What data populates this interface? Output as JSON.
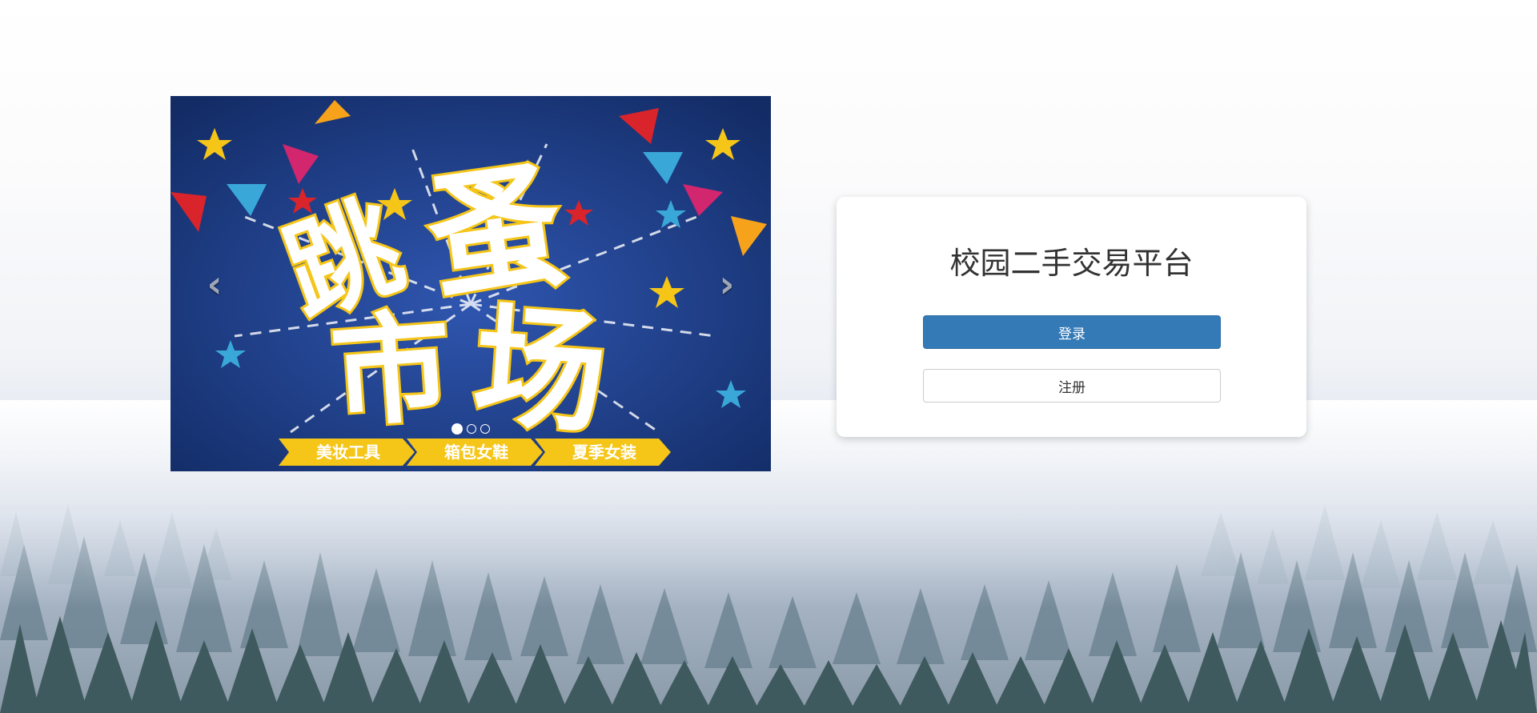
{
  "page": {
    "title": "校园二手交易平台"
  },
  "carousel": {
    "slide_text": {
      "char_1": "跳",
      "char_2": "蚤",
      "char_3": "市",
      "char_4": "场"
    },
    "ribbons": [
      "美妆工具",
      "箱包女鞋",
      "夏季女装"
    ],
    "prev_icon": "chevron-left-icon",
    "next_icon": "chevron-right-icon",
    "prev_glyph": "‹",
    "next_glyph": "›",
    "indicators": 3,
    "active_indicator": 1
  },
  "login": {
    "login_label": "登录",
    "register_label": "注册"
  },
  "colors": {
    "primary": "#337ab7",
    "banner_bg": "#1b3a7a",
    "ribbon": "#f5c518"
  }
}
